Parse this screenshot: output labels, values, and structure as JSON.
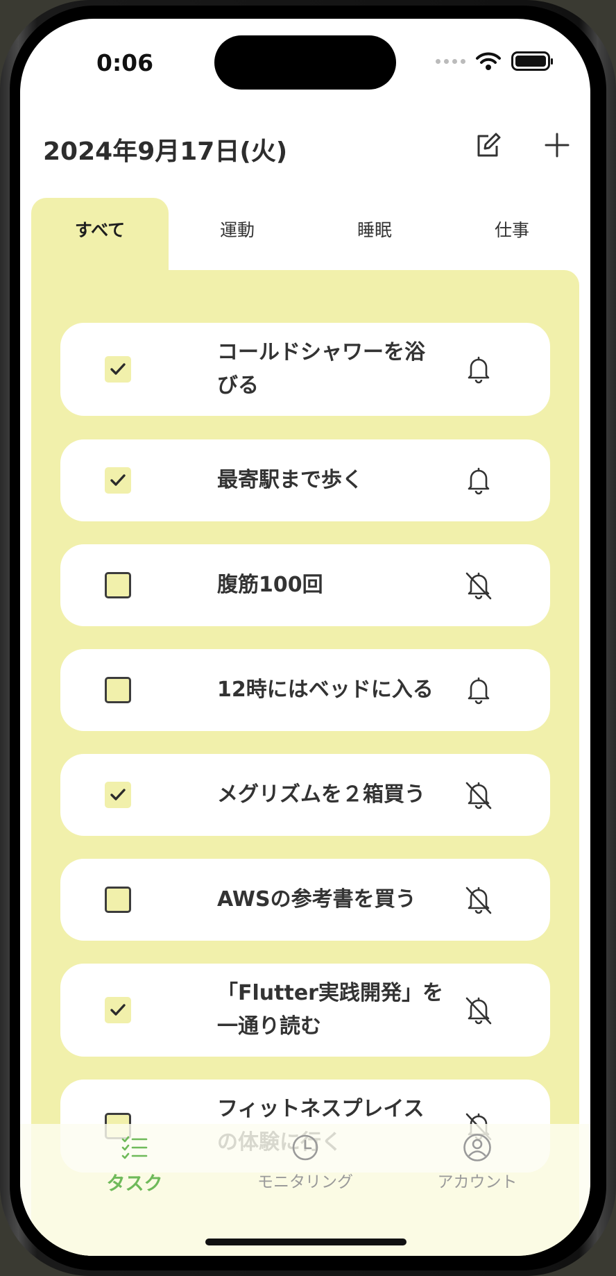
{
  "status_bar": {
    "time": "0:06"
  },
  "header": {
    "title": "2024年9月17日(火)",
    "edit_icon": "edit-icon",
    "add_icon": "plus-icon"
  },
  "tabs": [
    {
      "label": "すべて",
      "active": true
    },
    {
      "label": "運動",
      "active": false
    },
    {
      "label": "睡眠",
      "active": false
    },
    {
      "label": "仕事",
      "active": false
    }
  ],
  "colors": {
    "panel": "#f1f0ab",
    "accent_green": "#6fba5a"
  },
  "tasks": [
    {
      "line1": "コールドシャワーを浴",
      "line2": "びる",
      "checked": true,
      "reminder": true
    },
    {
      "line1": "最寄駅まで歩く",
      "line2": "",
      "checked": true,
      "reminder": true
    },
    {
      "line1": "腹筋100回",
      "line2": "",
      "checked": false,
      "reminder": false
    },
    {
      "line1": "12時にはベッドに入る",
      "line2": "",
      "checked": false,
      "reminder": true
    },
    {
      "line1": "メグリズムを２箱買う",
      "line2": "",
      "checked": true,
      "reminder": false
    },
    {
      "line1": "AWSの参考書を買う",
      "line2": "",
      "checked": false,
      "reminder": false
    },
    {
      "line1": "「Flutter実践開発」を",
      "line2": "一通り読む",
      "checked": true,
      "reminder": false
    },
    {
      "line1": "フィットネスプレイス",
      "line2": "の体験に行く",
      "checked": false,
      "reminder": false
    }
  ],
  "bottom_nav": [
    {
      "label": "タスク",
      "icon": "task-list-icon",
      "active": true
    },
    {
      "label": "モニタリング",
      "icon": "clock-icon",
      "active": false
    },
    {
      "label": "アカウント",
      "icon": "account-icon",
      "active": false
    }
  ]
}
